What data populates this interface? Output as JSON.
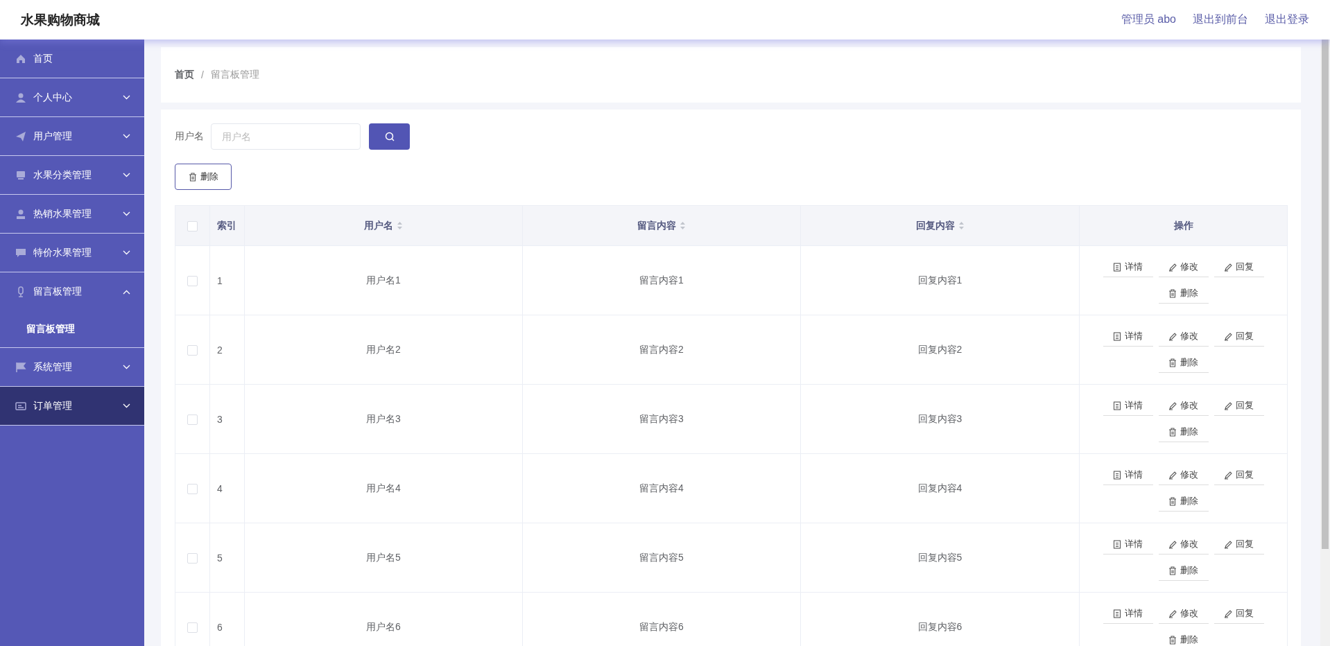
{
  "header": {
    "title": "水果购物商城",
    "links": [
      "管理员 abo",
      "退出到前台",
      "退出登录"
    ]
  },
  "sidebar": {
    "items": [
      {
        "label": "首页",
        "expandable": false,
        "hovered": false
      },
      {
        "label": "个人中心",
        "expandable": true,
        "expanded": false,
        "hovered": false
      },
      {
        "label": "用户管理",
        "expandable": true,
        "expanded": false,
        "hovered": false
      },
      {
        "label": "水果分类管理",
        "expandable": true,
        "expanded": false,
        "hovered": false
      },
      {
        "label": "热销水果管理",
        "expandable": true,
        "expanded": false,
        "hovered": false
      },
      {
        "label": "特价水果管理",
        "expandable": true,
        "expanded": false,
        "hovered": false
      },
      {
        "label": "留言板管理",
        "expandable": true,
        "expanded": true,
        "hovered": false,
        "children": [
          {
            "label": "留言板管理"
          }
        ]
      },
      {
        "label": "系统管理",
        "expandable": true,
        "expanded": false,
        "hovered": false
      },
      {
        "label": "订单管理",
        "expandable": true,
        "expanded": false,
        "hovered": true
      }
    ]
  },
  "breadcrumb": {
    "items": [
      "首页",
      "留言板管理"
    ],
    "separator": "/"
  },
  "select_all_checked": false,
  "search": {
    "label": "用户名",
    "placeholder": "用户名"
  },
  "delete_button": "删除",
  "table": {
    "columns": [
      {
        "label": "索引",
        "sortable": false
      },
      {
        "label": "用户名",
        "sortable": true
      },
      {
        "label": "留言内容",
        "sortable": true
      },
      {
        "label": "回复内容",
        "sortable": true
      },
      {
        "label": "操作",
        "sortable": false
      }
    ],
    "rows": [
      {
        "checked": false,
        "index": "1",
        "username": "用户名1",
        "message": "留言内容1",
        "reply": "回复内容1",
        "actions": [
          "详情",
          "修改",
          "回复",
          "删除"
        ]
      },
      {
        "checked": false,
        "index": "2",
        "username": "用户名2",
        "message": "留言内容2",
        "reply": "回复内容2",
        "actions": [
          "详情",
          "修改",
          "回复",
          "删除"
        ]
      },
      {
        "checked": false,
        "index": "3",
        "username": "用户名3",
        "message": "留言内容3",
        "reply": "回复内容3",
        "actions": [
          "详情",
          "修改",
          "回复",
          "删除"
        ]
      },
      {
        "checked": false,
        "index": "4",
        "username": "用户名4",
        "message": "留言内容4",
        "reply": "回复内容4",
        "actions": [
          "详情",
          "修改",
          "回复",
          "删除"
        ]
      },
      {
        "checked": false,
        "index": "5",
        "username": "用户名5",
        "message": "留言内容5",
        "reply": "回复内容5",
        "actions": [
          "详情",
          "修改",
          "回复",
          "删除"
        ]
      },
      {
        "checked": false,
        "index": "6",
        "username": "用户名6",
        "message": "留言内容6",
        "reply": "回复内容6",
        "actions": [
          "详情",
          "修改",
          "回复",
          "删除"
        ]
      }
    ]
  }
}
